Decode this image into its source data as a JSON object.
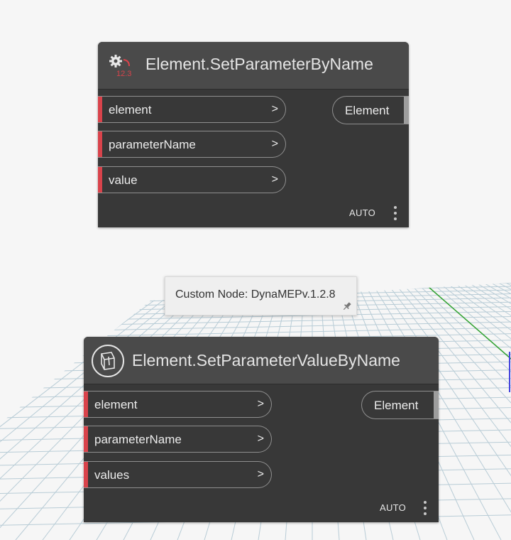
{
  "canvas": {
    "background_color": "#f6f6f6",
    "grid_color": "#b8ccd6",
    "axis_colors": {
      "green": "#33a333",
      "blue": "#4444dd"
    }
  },
  "node_top": {
    "title": "Element.SetParameterByName",
    "icon": "gear-number-icon",
    "inputs": [
      {
        "label": "element",
        "arrow": ">"
      },
      {
        "label": "parameterName",
        "arrow": ">"
      },
      {
        "label": "value",
        "arrow": ">"
      }
    ],
    "output": {
      "label": "Element"
    },
    "lacing": "AUTO"
  },
  "tooltip": {
    "text": "Custom Node: DynaMEPv.1.2.8",
    "icon": "pin-icon"
  },
  "node_bottom": {
    "title": "Element.SetParameterValueByName",
    "icon": "package-node-icon",
    "inputs": [
      {
        "label": "element",
        "arrow": ">"
      },
      {
        "label": "parameterName",
        "arrow": ">"
      },
      {
        "label": "values",
        "arrow": ">"
      }
    ],
    "output": {
      "label": "Element"
    },
    "lacing": "AUTO"
  }
}
